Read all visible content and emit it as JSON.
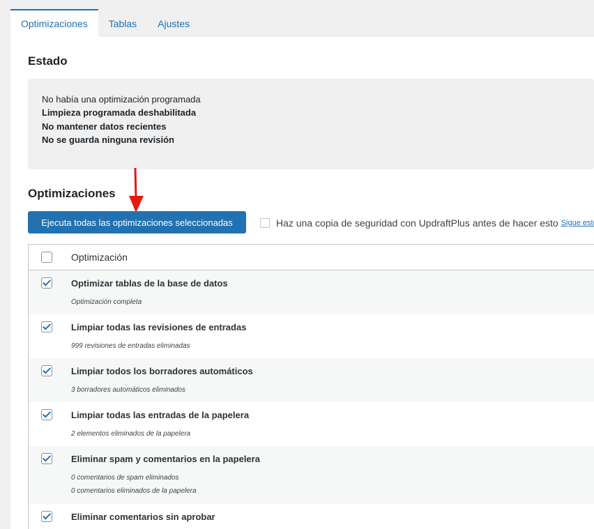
{
  "tabs": [
    {
      "label": "Optimizaciones",
      "active": true
    },
    {
      "label": "Tablas",
      "active": false
    },
    {
      "label": "Ajustes",
      "active": false
    }
  ],
  "status": {
    "heading": "Estado",
    "lines": [
      "No había una optimización programada",
      "Limpieza programada deshabilitada",
      "No mantener datos recientes",
      "No se guarda ninguna revisión"
    ]
  },
  "optimizations": {
    "heading": "Optimizaciones",
    "run_button": "Ejecuta todas las optimizaciones seleccionadas",
    "backup_label": "Haz una copia de seguridad con UpdraftPlus antes de hacer esto",
    "backup_link": "Sigue este e",
    "column_header": "Optimización",
    "rows": [
      {
        "title": "Optimizar tablas de la base de datos",
        "details": [
          "Optimización completa"
        ],
        "checked": true
      },
      {
        "title": "Limpiar todas las revisiones de entradas",
        "details": [
          "999 revisiones de entradas eliminadas"
        ],
        "checked": true
      },
      {
        "title": "Limpiar todos los borradores automáticos",
        "details": [
          "3 borradores automáticos eliminados"
        ],
        "checked": true
      },
      {
        "title": "Limpiar todas las entradas de la papelera",
        "details": [
          "2 elementos eliminados de la papelera"
        ],
        "checked": true
      },
      {
        "title": "Eliminar spam y comentarios en la papelera",
        "details": [
          "0 comentarios de spam eliminados",
          "0 comentarios eliminados de la papelera"
        ],
        "checked": true
      },
      {
        "title": "Eliminar comentarios sin aprobar",
        "details": [],
        "checked": true
      }
    ]
  },
  "colors": {
    "accent": "#2271b1",
    "arrow": "#e8170f"
  }
}
